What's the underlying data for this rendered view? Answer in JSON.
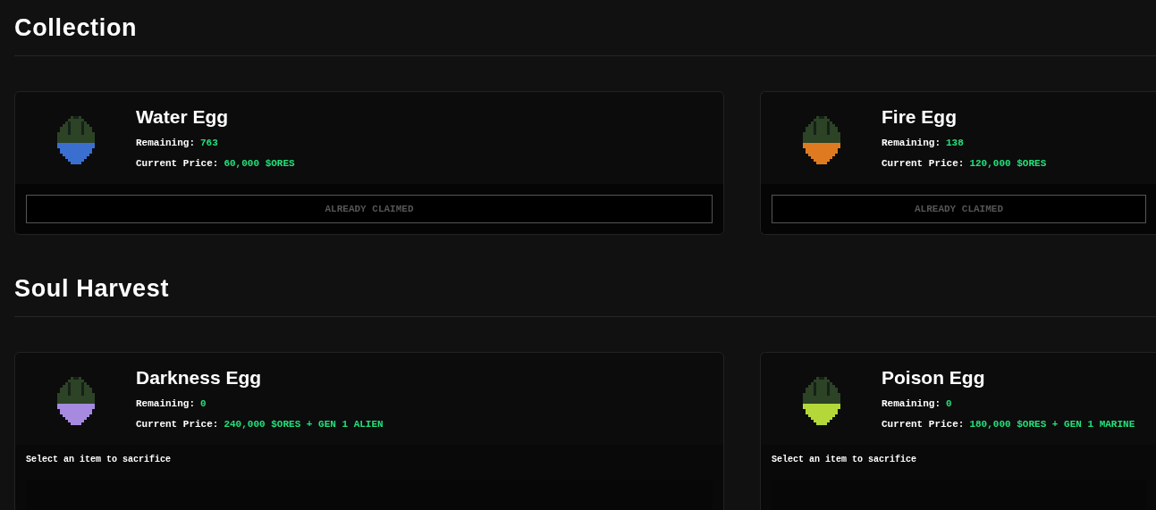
{
  "sections": [
    {
      "title": "Collection",
      "kind": "claim",
      "cards": [
        {
          "name": "Water Egg",
          "color": "#3a6fd0",
          "remaining_label": "Remaining:",
          "remaining": "763",
          "price_label": "Current Price:",
          "price": "60,000 $ORES",
          "button": "ALREADY CLAIMED",
          "disabled": true
        },
        {
          "name": "Fire Egg",
          "color": "#e07a20",
          "remaining_label": "Remaining:",
          "remaining": "138",
          "price_label": "Current Price:",
          "price": "120,000 $ORES",
          "button": "ALREADY CLAIMED",
          "disabled": true
        }
      ]
    },
    {
      "title": "Soul Harvest",
      "kind": "sacrifice",
      "cards": [
        {
          "name": "Darkness Egg",
          "color": "#a58ae0",
          "remaining_label": "Remaining:",
          "remaining": "0",
          "price_label": "Current Price:",
          "price": "240,000 $ORES + GEN 1 ALIEN",
          "prompt": "Select an item to sacrifice"
        },
        {
          "name": "Poison Egg",
          "color": "#b4d83a",
          "remaining_label": "Remaining:",
          "remaining": "0",
          "price_label": "Current Price:",
          "price": "180,000 $ORES + GEN 1 MARINE",
          "prompt": "Select an item to sacrifice"
        }
      ]
    }
  ]
}
